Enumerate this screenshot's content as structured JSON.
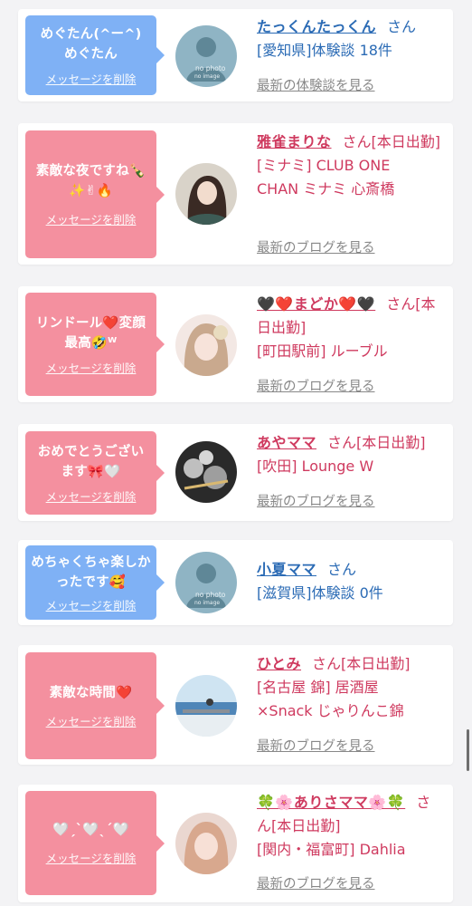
{
  "delete_label": "メッセージを削除",
  "colors": {
    "blue_bubble": "#7fb1f5",
    "pink_bubble": "#f4909f",
    "name_pink": "#cf3a5f",
    "name_blue": "#2b6bb5"
  },
  "cards": [
    {
      "bubble_color": "blue",
      "message": "めぐたん(^ー^)めぐたん",
      "avatar": "no-photo",
      "name": "たっくんたっくん",
      "suffix": "さん",
      "meta": "[愛知県]体験談 18件",
      "link": "最新の体験談を見る"
    },
    {
      "bubble_color": "pink",
      "message": "素敵な夜ですね🍾✨✌🔥",
      "avatar": "photo-woman-dark-hair",
      "name": "雅雀まりな",
      "suffix": "さん[本日出勤]",
      "meta": "[ミナミ] CLUB ONE CHAN ミナミ 心斎橋",
      "link": "最新のブログを見る"
    },
    {
      "bubble_color": "pink",
      "message": "リンドール❤️変顔最高🤣ᵂ",
      "avatar": "photo-woman-light-hair",
      "name": "🖤❤️まどか❤️🖤",
      "suffix": "さん[本日出勤]",
      "meta": "[町田駅前] ルーブル",
      "link": "最新のブログを見る"
    },
    {
      "bubble_color": "pink",
      "message": "おめでとうございます🎀🤍",
      "avatar": "photo-birthday-balloons",
      "name": "あやママ",
      "suffix": "さん[本日出勤]",
      "meta": "[吹田] Lounge W",
      "link": "最新のブログを見る"
    },
    {
      "bubble_color": "blue",
      "message": "めちゃくちゃ楽しかったです🥰",
      "avatar": "no-photo",
      "name": "小夏ママ",
      "suffix": "さん",
      "meta": "[滋賀県]体験談 0件",
      "link": ""
    },
    {
      "bubble_color": "pink",
      "message": "素敵な時間❤️",
      "avatar": "photo-seaside",
      "name": "ひとみ",
      "suffix": "さん[本日出勤]",
      "meta": "[名古屋 錦] 居酒屋×Snack じゃりんこ錦",
      "link": "最新のブログを見る"
    },
    {
      "bubble_color": "pink",
      "message": "🤍ˏˋ🤍ˎˊ🤍",
      "avatar": "photo-woman-blonde",
      "name": "🍀🌸ありさママ🌸🍀",
      "suffix": "さん[本日出勤]",
      "meta": "[関内・福富町] Dahlia",
      "link": "最新のブログを見る"
    }
  ],
  "no_photo_text": [
    "no photo",
    "no image"
  ]
}
